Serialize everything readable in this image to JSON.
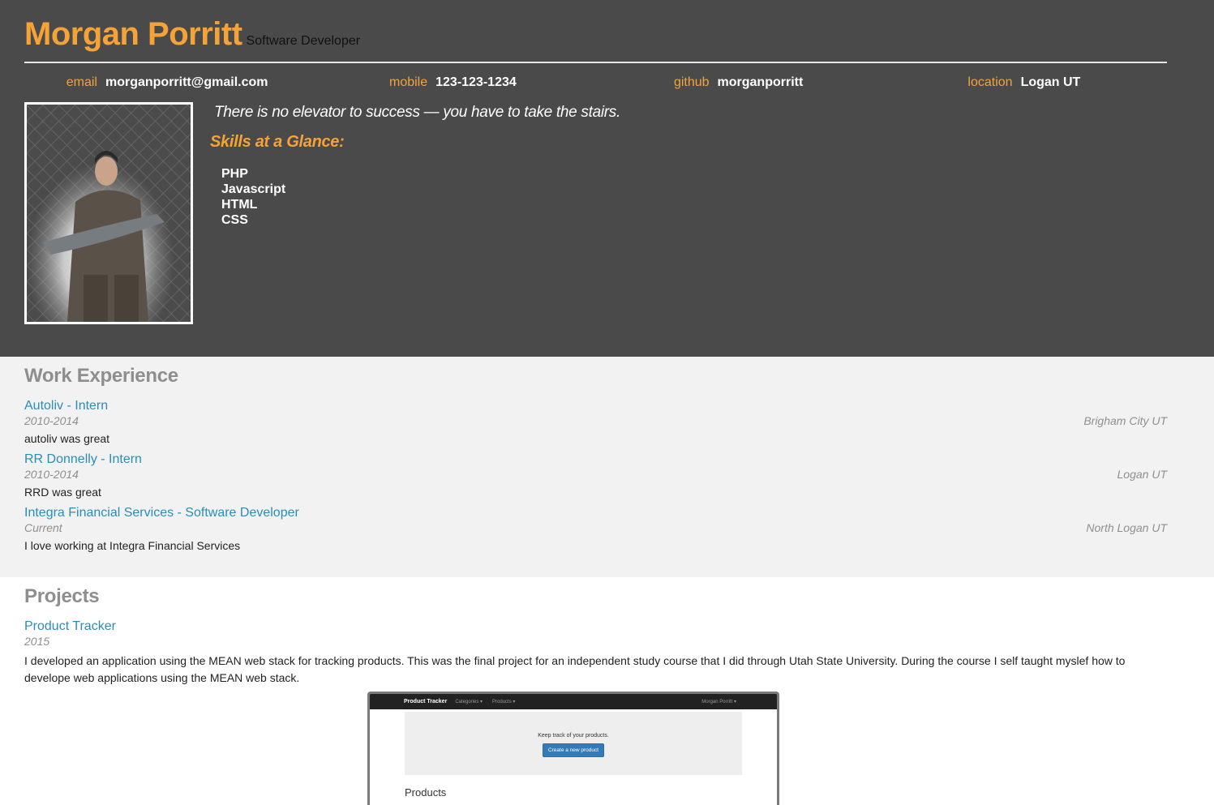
{
  "header": {
    "name": "Morgan Porritt",
    "subtitle": "Software Developer",
    "contacts": [
      {
        "label": "email",
        "value": "morganporritt@gmail.com"
      },
      {
        "label": "mobile",
        "value": "123-123-1234"
      },
      {
        "label": "github",
        "value": "morganporritt"
      },
      {
        "label": "location",
        "value": "Logan UT"
      }
    ],
    "quote": "There is no elevator to success — you have to take the stairs.",
    "skills_title": "Skills at a Glance:",
    "skills": [
      "PHP",
      "Javascript",
      "HTML",
      "CSS"
    ]
  },
  "work": {
    "title": "Work Experience",
    "jobs": [
      {
        "title": "Autoliv - Intern",
        "dates": "2010-2014",
        "location": "Brigham City UT",
        "description": "autoliv was great"
      },
      {
        "title": "RR Donnelly - Intern",
        "dates": "2010-2014",
        "location": "Logan UT",
        "description": "RRD was great"
      },
      {
        "title": "Integra Financial Services - Software Developer",
        "dates": "Current",
        "location": "North Logan UT",
        "description": "I love working at Integra Financial Services"
      }
    ]
  },
  "projects": {
    "title": "Projects",
    "items": [
      {
        "title": "Product Tracker",
        "year": "2015",
        "description": "I developed an application using the MEAN web stack for tracking products. This was the final project for an independent study course that I did through Utah State University. During the course I self taught myslef how to develope web applications using the MEAN web stack.",
        "screenshot": {
          "brand": "Product Tracker",
          "nav": [
            "Categories ▾",
            "Products ▾"
          ],
          "user": "Morgan Porritt ▾",
          "jumbo_text": "Keep track of your products.",
          "button": "Create a new product",
          "heading": "Products"
        }
      }
    ]
  },
  "colors": {
    "accent": "#f5a336",
    "link": "#2a8dbb",
    "header_bg": "#4a4a4a",
    "work_bg": "#f2f2f2"
  }
}
